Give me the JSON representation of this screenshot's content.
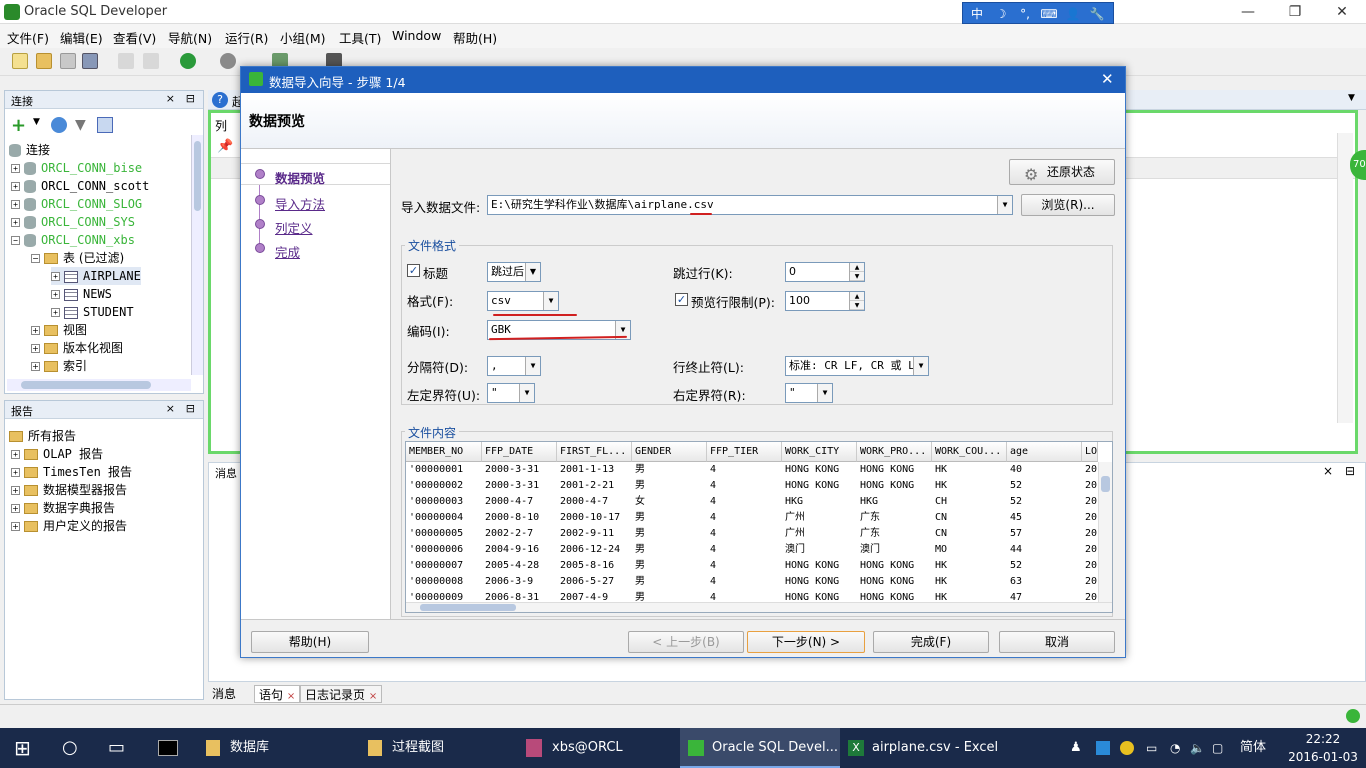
{
  "window": {
    "title": "Oracle SQL Developer",
    "minimize": "—",
    "restore": "❐",
    "close": "✕"
  },
  "ime": {
    "buttons": [
      "中",
      "☽",
      "°,",
      "⌨",
      "👤",
      "🔧"
    ]
  },
  "menu": [
    "文件(F)",
    "编辑(E)",
    "查看(V)",
    "导航(N)",
    "运行(R)",
    "小组(M)",
    "工具(T)",
    "Window",
    "帮助(H)"
  ],
  "connections_pane": {
    "title": "连接",
    "root": "连接",
    "items": [
      {
        "label": "ORCL_CONN_bise",
        "green": true
      },
      {
        "label": "ORCL_CONN_scott",
        "green": false
      },
      {
        "label": "ORCL_CONN_SLOG",
        "green": true
      },
      {
        "label": "ORCL_CONN_SYS",
        "green": true
      },
      {
        "label": "ORCL_CONN_xbs",
        "green": true
      }
    ],
    "tables_node": "表 (已过滤)",
    "tables": [
      "AIRPLANE",
      "NEWS",
      "STUDENT"
    ],
    "other_nodes": [
      "视图",
      "版本化视图",
      "索引"
    ]
  },
  "reports_pane": {
    "title": "报告",
    "items": [
      "所有报告",
      "OLAP 报告",
      "TimesTen 报告",
      "数据模型器报告",
      "数据字典报告",
      "用户定义的报告"
    ]
  },
  "editor": {
    "tab_label": "起",
    "col_label": "列",
    "messages_label": "消息",
    "badge": "70"
  },
  "dialog": {
    "title": "数据导入向导 - 步骤 1/4",
    "header": "数据预览",
    "steps": [
      {
        "label": "数据预览",
        "active": true
      },
      {
        "label": "导入方法",
        "active": false
      },
      {
        "label": "列定义",
        "active": false
      },
      {
        "label": "完成",
        "active": false
      }
    ],
    "restore_button": "还原状态",
    "file_label": "导入数据文件:",
    "file_value": "E:\\研究生学科作业\\数据库\\airplane.csv",
    "browse_button": "浏览(R)...",
    "format_group": "文件格式",
    "header_label": "标题",
    "header_checked": true,
    "header_option": "跳过后",
    "skip_rows_label": "跳过行(K):",
    "skip_rows_value": "0",
    "format_label": "格式(F):",
    "format_value": "csv",
    "preview_limit_label": "预览行限制(P):",
    "preview_limit_checked": true,
    "preview_limit_value": "100",
    "encoding_label": "编码(I):",
    "encoding_value": "GBK",
    "delimiter_label": "分隔符(D):",
    "delimiter_value": ",",
    "line_term_label": "行终止符(L):",
    "line_term_value": "标准: CR LF, CR 或 LF",
    "left_enclosure_label": "左定界符(U):",
    "left_enclosure_value": "\"",
    "right_enclosure_label": "右定界符(R):",
    "right_enclosure_value": "\"",
    "content_group": "文件内容",
    "preview": {
      "columns": [
        "MEMBER_NO",
        "FFP_DATE",
        "FIRST_FL...",
        "GENDER",
        "FFP_TIER",
        "WORK_CITY",
        "WORK_PRO...",
        "WORK_COU...",
        "age",
        "LO"
      ],
      "rows": [
        [
          "'00000001",
          "2000-3-31",
          "2001-1-13",
          "男",
          "4",
          "HONG KONG",
          "HONG KONG",
          "HK",
          "40",
          "20"
        ],
        [
          "'00000002",
          "2000-3-31",
          "2001-2-21",
          "男",
          "4",
          "HONG KONG",
          "HONG KONG",
          "HK",
          "52",
          "20"
        ],
        [
          "'00000003",
          "2000-4-7",
          "2000-4-7",
          "女",
          "4",
          "HKG",
          "HKG",
          "CH",
          "52",
          "20"
        ],
        [
          "'00000004",
          "2000-8-10",
          "2000-10-17",
          "男",
          "4",
          "广州",
          "广东",
          "CN",
          "45",
          "20"
        ],
        [
          "'00000005",
          "2002-2-7",
          "2002-9-11",
          "男",
          "4",
          "广州",
          "广东",
          "CN",
          "57",
          "20"
        ],
        [
          "'00000006",
          "2004-9-16",
          "2006-12-24",
          "男",
          "4",
          "澳门",
          "澳门",
          "MO",
          "44",
          "20"
        ],
        [
          "'00000007",
          "2005-4-28",
          "2005-8-16",
          "男",
          "4",
          "HONG KONG",
          "HONG KONG",
          "HK",
          "52",
          "20"
        ],
        [
          "'00000008",
          "2006-3-9",
          "2006-5-27",
          "男",
          "4",
          "HONG KONG",
          "HONG KONG",
          "HK",
          "63",
          "20"
        ],
        [
          "'00000009",
          "2006-8-31",
          "2007-4-9",
          "男",
          "4",
          "HONG KONG",
          "HONG KONG",
          "HK",
          "47",
          "20"
        ]
      ]
    },
    "help_button": "帮助(H)",
    "back_button": "< 上一步(B)",
    "next_button": "下一步(N) >",
    "finish_button": "完成(F)",
    "cancel_button": "取消"
  },
  "bottom_tabs": [
    "消息",
    "语句",
    "日志记录页"
  ],
  "taskbar": {
    "items": [
      "数据库",
      "过程截图",
      "xbs@ORCL",
      "Oracle SQL Devel...",
      "airplane.csv - Excel"
    ],
    "active": "Oracle SQL Devel...",
    "lang": "简体",
    "time": "22:22",
    "date": "2016-01-03"
  }
}
